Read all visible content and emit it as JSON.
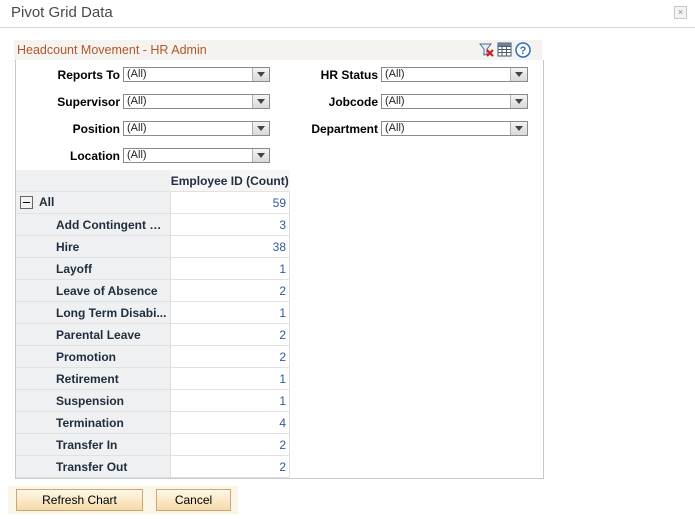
{
  "window": {
    "title": "Pivot Grid Data",
    "close_glyph": "×"
  },
  "panel": {
    "title": "Headcount Movement - HR Admin",
    "tools": [
      "filter-clear-icon",
      "grid-icon",
      "help-icon"
    ],
    "help_glyph": "?"
  },
  "filters": {
    "reports_to": {
      "label": "Reports To",
      "value": "(All)"
    },
    "supervisor": {
      "label": "Supervisor",
      "value": "(All)"
    },
    "position": {
      "label": "Position",
      "value": "(All)"
    },
    "location": {
      "label": "Location",
      "value": "(All)"
    },
    "hr_status": {
      "label": "HR Status",
      "value": "(All)"
    },
    "jobcode": {
      "label": "Jobcode",
      "value": "(All)"
    },
    "department": {
      "label": "Department",
      "value": "(All)"
    }
  },
  "grid": {
    "column_header": "Employee ID (Count)",
    "total_label": "All",
    "total_value": "59",
    "rows": [
      {
        "label": "Add Contingent W...",
        "value": "3"
      },
      {
        "label": "Hire",
        "value": "38"
      },
      {
        "label": "Layoff",
        "value": "1"
      },
      {
        "label": "Leave of Absence",
        "value": "2"
      },
      {
        "label": "Long Term Disabi...",
        "value": "1"
      },
      {
        "label": "Parental Leave",
        "value": "2"
      },
      {
        "label": "Promotion",
        "value": "2"
      },
      {
        "label": "Retirement",
        "value": "1"
      },
      {
        "label": "Suspension",
        "value": "1"
      },
      {
        "label": "Termination",
        "value": "4"
      },
      {
        "label": "Transfer In",
        "value": "2"
      },
      {
        "label": "Transfer Out",
        "value": "2"
      }
    ]
  },
  "buttons": {
    "refresh": "Refresh Chart",
    "cancel": "Cancel"
  },
  "colors": {
    "panel_title": "#b3562b",
    "count_value": "#2d5a9e",
    "button_bg": "#f6d9a8"
  }
}
